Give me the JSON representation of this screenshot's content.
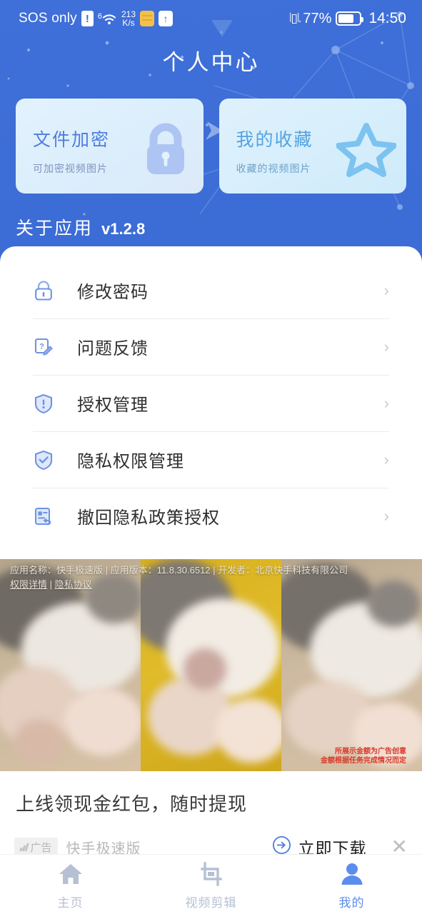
{
  "theme": {
    "bg_blue": "#3a6ad3",
    "accent": "#5b8def",
    "card1_text": "#4f7ddd",
    "card2_text": "#53a3e2",
    "nav_inactive": "#b6c0d3",
    "ad_red": "#d83a2c"
  },
  "statusbar": {
    "carrier": "SOS only",
    "sim_warning_icon": "sim-warning-icon",
    "wifi_icon": "wifi-icon",
    "wifi_generation": "6",
    "net_speed": "213",
    "net_speed_unit": "K/s",
    "sim_icon": "sim-card-icon",
    "upload_icon": "upload-arrow-icon",
    "nav_marker_icon": "navigation-triangle-icon",
    "vibrate_icon": "vibrate-icon",
    "battery_pct": "77%",
    "battery_icon": "battery-icon",
    "clock": "14:50"
  },
  "header": {
    "title": "个人中心"
  },
  "cards": [
    {
      "name": "file-encrypt",
      "title": "文件加密",
      "subtitle": "可加密视频图片",
      "icon": "lock-icon"
    },
    {
      "name": "my-favorites",
      "title": "我的收藏",
      "subtitle": "收藏的视频图片",
      "icon": "star-icon"
    }
  ],
  "about": {
    "label": "关于应用",
    "version": "v1.2.8"
  },
  "menu": [
    {
      "label": "修改密码",
      "icon": "lock-outline-icon",
      "chevron": "›"
    },
    {
      "label": "问题反馈",
      "icon": "feedback-pencil-icon",
      "chevron": "›"
    },
    {
      "label": "授权管理",
      "icon": "shield-alert-icon",
      "chevron": "›"
    },
    {
      "label": "隐私权限管理",
      "icon": "shield-check-icon",
      "chevron": "›"
    },
    {
      "label": "撤回隐私政策授权",
      "icon": "document-undo-icon",
      "chevron": "›"
    }
  ],
  "ad": {
    "legal_line1": "应用名称：快手极速版 | 应用版本：11.8.30.6512 | 开发者：北京快手科技有限公司",
    "legal_permissions": "权限详情",
    "legal_separator": " | ",
    "legal_privacy": "隐私协议",
    "red_note_line1": "所展示金额为广告创意",
    "red_note_line2": "金额根据任务完成情况而定",
    "headline": "上线领现金红包，随时提现",
    "tag": "广告",
    "tag_icon": "ad-bars-icon",
    "brand": "快手极速版",
    "download_label": "立即下载",
    "download_icon": "arrow-circle-right-icon",
    "close_icon": "close-icon"
  },
  "bottomnav": [
    {
      "label": "主页",
      "icon": "home-icon",
      "active": false
    },
    {
      "label": "视频剪辑",
      "icon": "crop-icon",
      "active": false
    },
    {
      "label": "我的",
      "icon": "person-icon",
      "active": true
    }
  ]
}
